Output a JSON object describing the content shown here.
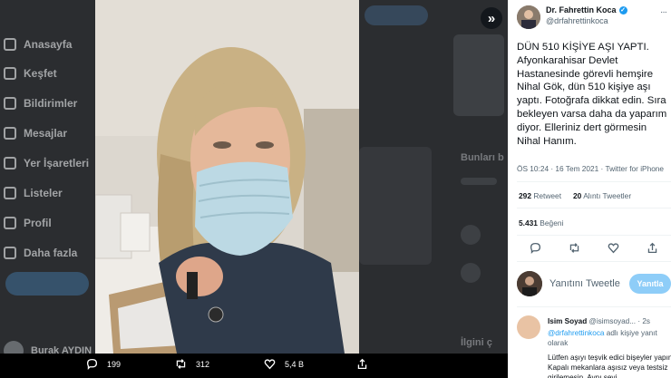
{
  "background_nav": [
    {
      "label": "Anasayfa"
    },
    {
      "label": "Keşfet"
    },
    {
      "label": "Bildirimler"
    },
    {
      "label": "Mesajlar"
    },
    {
      "label": "Yer İşaretleri"
    },
    {
      "label": "Listeler"
    },
    {
      "label": "Profil"
    },
    {
      "label": "Daha fazla"
    }
  ],
  "background_user": {
    "name": "Burak AYDIN"
  },
  "background_right": {
    "section1": "Bunları b",
    "section2": "İlgini ç"
  },
  "viewer": {
    "expand_icon": "chevrons-right-icon",
    "actions": {
      "replies": "199",
      "retweets": "312",
      "likes": "5,4 B"
    }
  },
  "tweet": {
    "author_name": "Dr. Fahrettin Koca",
    "author_handle": "@drfahrettinkoca",
    "text": "DÜN 510 KİŞİYE AŞI YAPTI. Afyonkarahisar Devlet Hastanesinde görevli hemşire Nihal Gök, dün 510 kişiye aşı yaptı. Fotoğrafa dikkat edin. Sıra bekleyen varsa daha da yaparım diyor. Elleriniz dert görmesin Nihal Hanım.",
    "meta": "ÖS 10:24 · 16 Tem 2021 · Twitter for iPhone",
    "retweets_count": "292",
    "retweets_label": "Retweet",
    "quotes_count": "20",
    "quotes_label": "Alıntı Tweetler",
    "likes_count": "5.431",
    "likes_label": "Beğeni"
  },
  "reply_compose": {
    "placeholder": "Yanıtını Tweetle",
    "button": "Yanıtla"
  },
  "reply": {
    "name": "Isim Soyad",
    "handle": "@isimsoyad...",
    "time": "· 2s",
    "replying_to_handle": "@drfahrettinkoca",
    "replying_to_suffix": " adlı kişiye yanıt olarak",
    "text": "Lütfen aşıyı teşvik edici bişeyler yapın. Kapalı mekanlara aşısız veya testsiz girilemesin. Aynı şeyi"
  },
  "colors": {
    "accent": "#1d9bf0",
    "button_disabled": "#8ecdf8",
    "text_secondary": "#536471"
  }
}
